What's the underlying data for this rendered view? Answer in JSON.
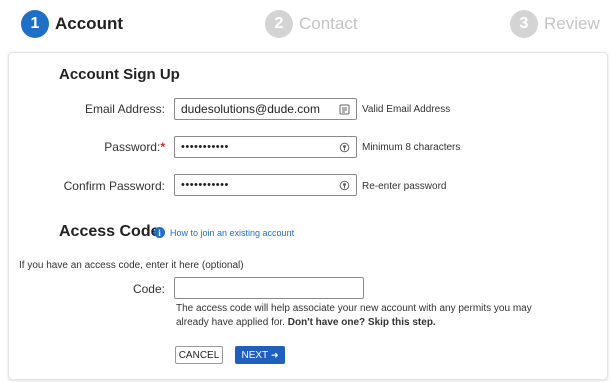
{
  "stepper": {
    "steps": [
      {
        "number": "1",
        "label": "Account"
      },
      {
        "number": "2",
        "label": "Contact"
      },
      {
        "number": "3",
        "label": "Review"
      }
    ]
  },
  "signup": {
    "title": "Account Sign Up",
    "email": {
      "label": "Email Address:",
      "value": "dudesolutions@dude.com",
      "hint": "Valid Email Address"
    },
    "password": {
      "label": "Password:",
      "required_mark": "*",
      "value": "•••••••••••",
      "hint": "Minimum 8 characters"
    },
    "confirm": {
      "label": "Confirm Password:",
      "value": "•••••••••••",
      "hint": "Re-enter password"
    }
  },
  "access": {
    "title": "Access Code",
    "info_link": "How to join an existing account",
    "intro": "If you have an access code, enter it here (optional)",
    "code_label": "Code:",
    "code_value": "",
    "note_text": "The access code will help associate your new account with any permits you may already have applied for.",
    "note_bold": "Don't have one? Skip this step."
  },
  "buttons": {
    "cancel": "CANCEL",
    "next": "NEXT",
    "next_arrow": "➜"
  },
  "colors": {
    "accent": "#1f6fc7",
    "required": "#d9261c",
    "inactive_step": "#d4d4d4"
  }
}
